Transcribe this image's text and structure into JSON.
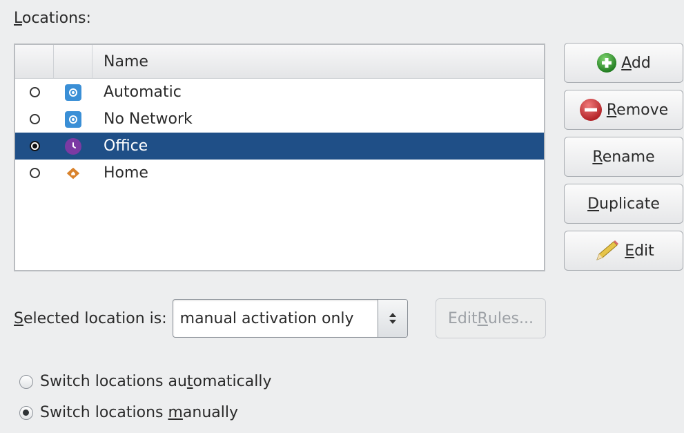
{
  "section_label_underline": "L",
  "section_label_rest": "ocations:",
  "list": {
    "header_name": "Name",
    "rows": [
      {
        "name": "Automatic",
        "selected": false,
        "active": false,
        "icon": "gear-icon"
      },
      {
        "name": "No Network",
        "selected": false,
        "active": false,
        "icon": "gear-icon"
      },
      {
        "name": "Office",
        "selected": true,
        "active": true,
        "icon": "clock-icon"
      },
      {
        "name": "Home",
        "selected": false,
        "active": false,
        "icon": "home-icon"
      }
    ]
  },
  "buttons": {
    "add_underline": "A",
    "add_rest": "dd",
    "remove_underline": "R",
    "remove_rest": "emove",
    "rename_underline": "R",
    "rename_rest": "ename",
    "duplicate_underline": "D",
    "duplicate_rest": "uplicate",
    "edit_underline": "E",
    "edit_rest": "dit"
  },
  "selected_location": {
    "label_underline": "S",
    "label_rest": "elected location is:",
    "combo_value": "manual activation only",
    "edit_rules_prefix": "Edit ",
    "edit_rules_underline": "R",
    "edit_rules_rest": "ules..."
  },
  "switch_options": {
    "auto_pre": "Switch locations au",
    "auto_underline": "t",
    "auto_post": "omatically",
    "auto_checked": false,
    "manual_pre": "Switch locations ",
    "manual_underline": "m",
    "manual_post": "anually",
    "manual_checked": true
  },
  "colors": {
    "selection": "#1f4f87",
    "add_green": "#2e8b2e",
    "remove_red": "#c0282d"
  }
}
